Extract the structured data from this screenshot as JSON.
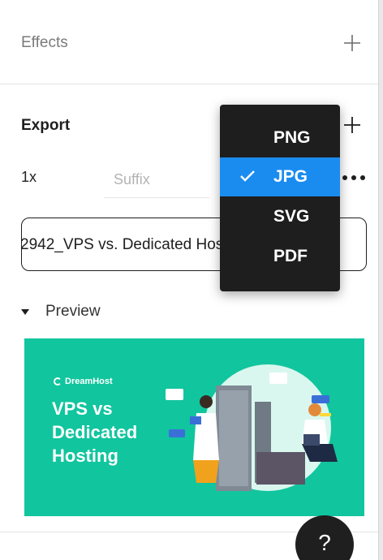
{
  "effects": {
    "title": "Effects"
  },
  "export": {
    "title": "Export",
    "scale": "1x",
    "suffix_placeholder": "Suffix",
    "export_button_label": "2942_VPS vs. Dedicated Hosting — Which"
  },
  "format_menu": {
    "items": [
      {
        "label": "PNG",
        "selected": false
      },
      {
        "label": "JPG",
        "selected": true
      },
      {
        "label": "SVG",
        "selected": false
      },
      {
        "label": "PDF",
        "selected": false
      }
    ],
    "selected_color": "#1a8cf0"
  },
  "preview": {
    "label": "Preview",
    "image": {
      "brand": "DreamHost",
      "title": "VPS vs\nDedicated\nHosting",
      "background_color": "#11c59e"
    }
  },
  "help": {
    "label": "?"
  },
  "icons": [
    "plus-icon",
    "check-icon",
    "more-icon",
    "caret-down-icon",
    "help-icon"
  ]
}
